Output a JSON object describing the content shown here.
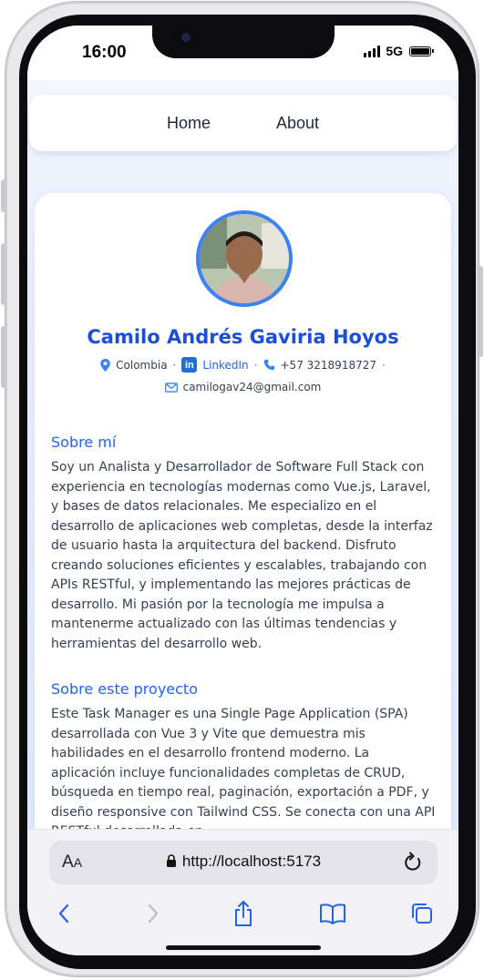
{
  "status_bar": {
    "time": "16:00",
    "network": "5G"
  },
  "nav": {
    "home": "Home",
    "about": "About"
  },
  "profile": {
    "name": "Camilo Andrés Gaviria Hoyos",
    "location": "Colombia",
    "linkedin_label": "LinkedIn",
    "linkedin_badge": "in",
    "phone": "+57 3218918727",
    "email": "camilogav24@gmail.com",
    "separator": "·"
  },
  "about_me": {
    "title": "Sobre mí",
    "body": "Soy un Analista y Desarrollador de Software Full Stack con experiencia en tecnologías modernas como Vue.js, Laravel, y bases de datos relacionales. Me especializo en el desarrollo de aplicaciones web completas, desde la interfaz de usuario hasta la arquitectura del backend. Disfruto creando soluciones eficientes y escalables, trabajando con APIs RESTful, y implementando las mejores prácticas de desarrollo. Mi pasión por la tecnología me impulsa a mantenerme actualizado con las últimas tendencias y herramientas del desarrollo web."
  },
  "about_project": {
    "title": "Sobre este proyecto",
    "body": "Este Task Manager es una Single Page Application (SPA) desarrollada con Vue 3 y Vite que demuestra mis habilidades en el desarrollo frontend moderno. La aplicación incluye funcionalidades completas de CRUD, búsqueda en tiempo real, paginación, exportación a PDF, y diseño responsive con Tailwind CSS. Se conecta con una API RESTful desarrollada en"
  },
  "browser": {
    "aa_big": "A",
    "aa_small": "A",
    "url": "http://localhost:5173"
  },
  "icons": {
    "location": "map-pin-icon",
    "phone": "phone-icon",
    "email": "mail-icon",
    "lock": "lock-icon",
    "reload": "reload-icon",
    "back": "back-chevron-icon",
    "forward": "forward-chevron-icon",
    "share": "share-icon",
    "bookmarks": "book-icon",
    "tabs": "tabs-icon"
  },
  "colors": {
    "accent": "#2563eb",
    "name": "#1d4ed8",
    "avatar_ring": "#3b82f6",
    "linkedin": "#1d6fd8"
  }
}
